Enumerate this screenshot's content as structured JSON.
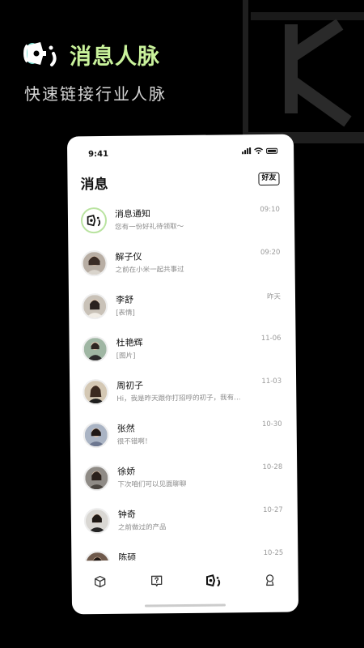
{
  "promo": {
    "title": "消息人脉",
    "subtitle": "快速链接行业人脉"
  },
  "status_bar": {
    "time": "9:41"
  },
  "header": {
    "title": "消息",
    "friends_label": "好友"
  },
  "messages": [
    {
      "name": "消息通知",
      "preview": "您有一份好礼待领取～",
      "time": "09:10",
      "type": "system"
    },
    {
      "name": "解子仪",
      "preview": "之前在小米一起共事过",
      "time": "09:20",
      "type": "person"
    },
    {
      "name": "李舒",
      "preview": "[表情]",
      "time": "昨天",
      "type": "person"
    },
    {
      "name": "杜艳辉",
      "preview": "[图片]",
      "time": "11-06",
      "type": "person"
    },
    {
      "name": "周初子",
      "preview": "Hi，我是昨天跟你打招呼的初子，我有…",
      "time": "11-03",
      "type": "person"
    },
    {
      "name": "张然",
      "preview": "很不错啊！",
      "time": "10-30",
      "type": "person"
    },
    {
      "name": "徐娇",
      "preview": "下次咱们可以见面聊聊",
      "time": "10-28",
      "type": "person"
    },
    {
      "name": "钟奇",
      "preview": "之前做过的产品",
      "time": "10-27",
      "type": "person"
    },
    {
      "name": "陈硕",
      "preview": "",
      "time": "10-25",
      "type": "person"
    }
  ],
  "tabs": [
    {
      "icon": "cube-icon"
    },
    {
      "icon": "question-icon"
    },
    {
      "icon": "megaphone-icon",
      "active": true
    },
    {
      "icon": "profile-icon"
    }
  ],
  "colors": {
    "accent": "#c9f29b",
    "background": "#000000",
    "card": "#ffffff"
  }
}
